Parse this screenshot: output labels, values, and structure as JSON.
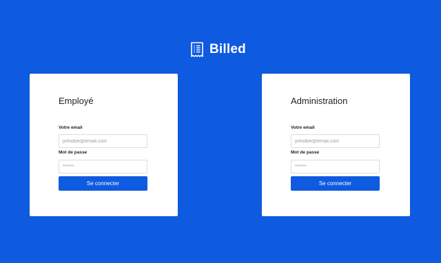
{
  "brand": {
    "name": "Billed",
    "icon": "bill-receipt-icon"
  },
  "colors": {
    "background": "#0e5ae0",
    "button": "#0e5ae0",
    "card": "#ffffff"
  },
  "employee_form": {
    "title": "Employé",
    "email_label": "Votre email",
    "email_placeholder": "johndoe@email.com",
    "password_label": "Mot de passe",
    "password_placeholder": "******",
    "submit_label": "Se connecter"
  },
  "admin_form": {
    "title": "Administration",
    "email_label": "Votre email",
    "email_placeholder": "johndoe@email.com",
    "password_label": "Mot de passe",
    "password_placeholder": "******",
    "submit_label": "Se connecter"
  }
}
